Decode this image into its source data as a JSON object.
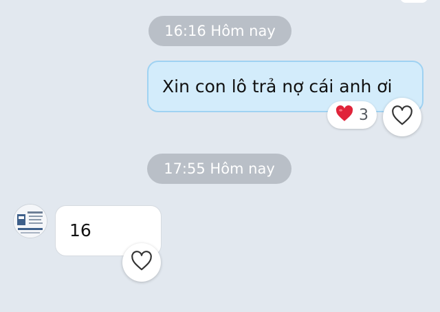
{
  "colors": {
    "background": "#e2e8ef",
    "time_pill": "#b9bfc7",
    "outgoing_bubble": "#d3ecfb",
    "outgoing_border": "#9fd2f2",
    "incoming_bubble": "#ffffff",
    "heart_red": "#e0243a"
  },
  "messages": [
    {
      "timestamp": "16:16 Hôm nay",
      "direction": "outgoing",
      "text": "Xin con lô trả nợ cái anh ơi",
      "reaction": {
        "icon": "red-heart-icon",
        "count": "3"
      }
    },
    {
      "timestamp": "17:55 Hôm nay",
      "direction": "incoming",
      "text": "16"
    }
  ]
}
